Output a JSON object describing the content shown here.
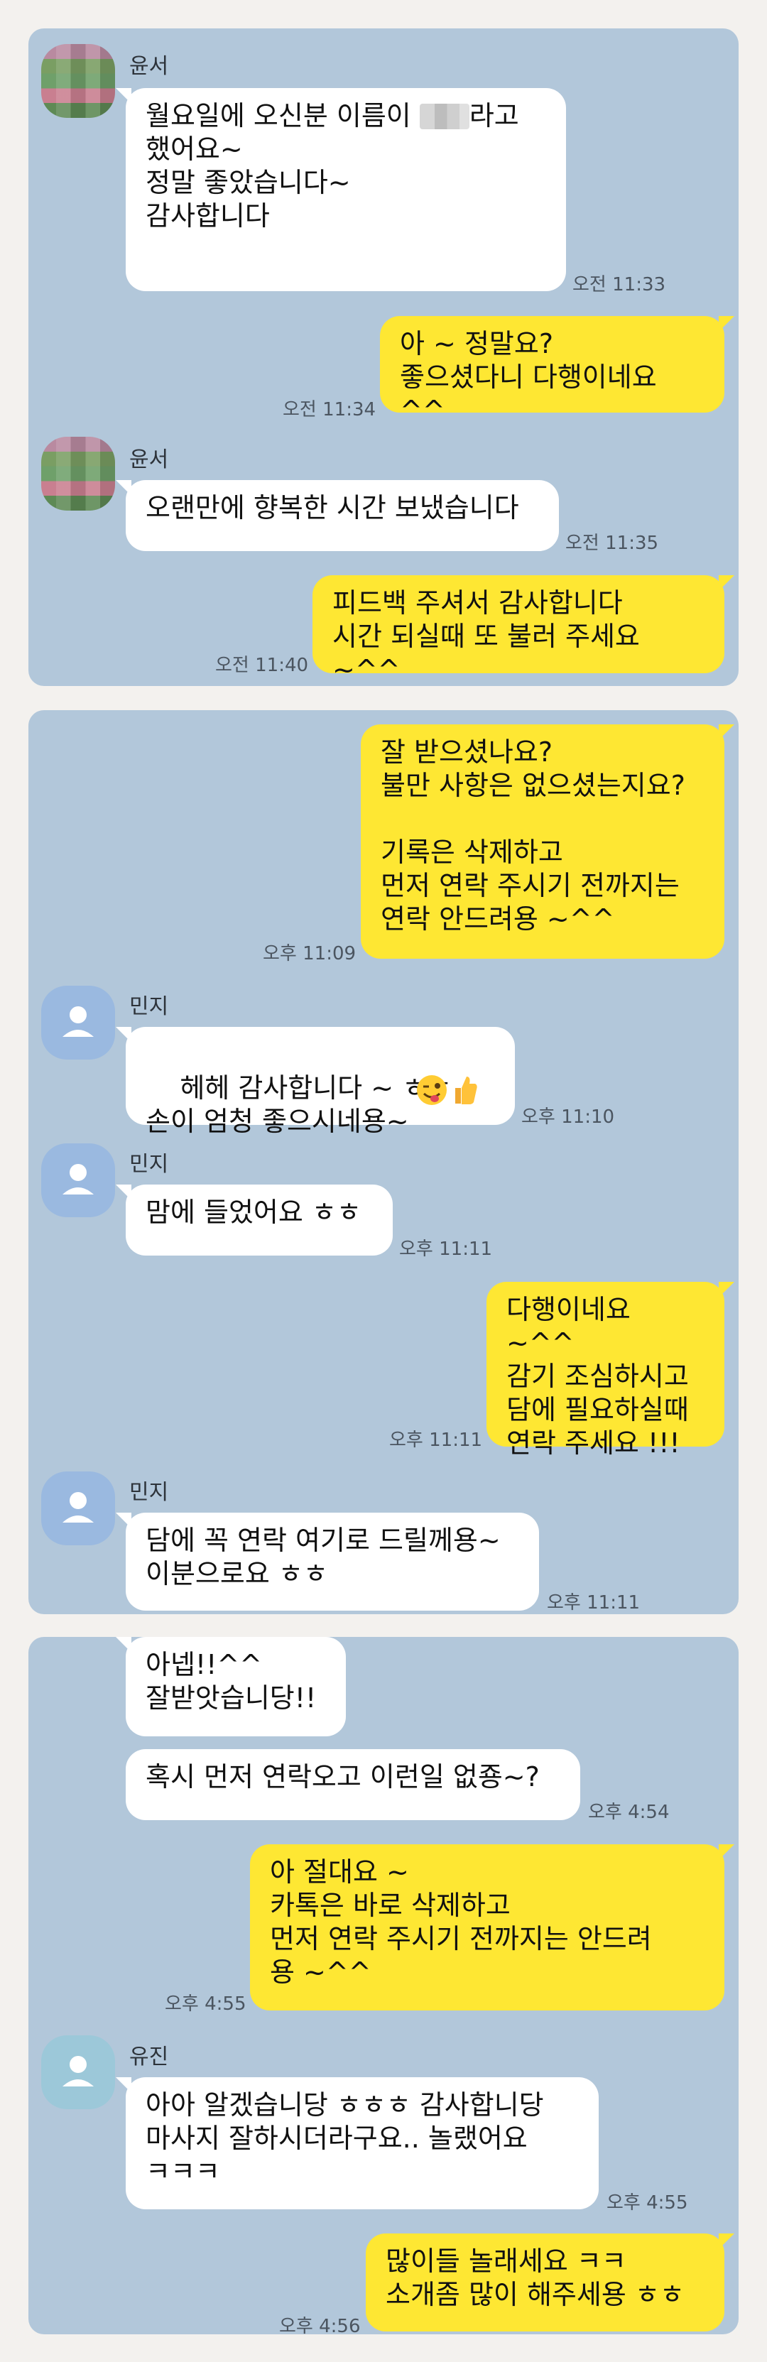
{
  "panel1": {
    "sender1": "윤서",
    "m1": {
      "line1a": "월요일에 오신분 이름이 ",
      "line1b": "라고",
      "rest": "했어요~\n정말 좋았습니다~\n감사합니다",
      "time": "오전 11:33"
    },
    "m2": {
      "text": "아 ~ 정말요?\n좋으셨다니 다행이네요 ^^",
      "time": "오전 11:34"
    },
    "sender2": "윤서",
    "m3": {
      "text": "오랜만에 향복한 시간 보냈습니다",
      "time": "오전 11:35"
    },
    "m4": {
      "text": "피드백 주셔서 감사합니다\n시간 되실때 또 불러 주세요 ~^^",
      "time": "오전 11:40"
    }
  },
  "panel2": {
    "m1": {
      "text": "잘 받으셨나요?\n불만 사항은 없으셨는지요?\n\n기록은 삭제하고\n먼저 연락 주시기 전까지는\n연락 안드려용 ~^^",
      "time": "오후 11:09"
    },
    "sender1": "민지",
    "m2": {
      "text": "헤헤 감사합니다 ~ ㅎㅎ\n손이 엄청 좋으시네용~",
      "time": "오후 11:10"
    },
    "sender2": "민지",
    "m3": {
      "text": "맘에 들었어요 ㅎㅎ",
      "time": "오후 11:11"
    },
    "m4": {
      "text": "다행이네요 ~^^\n감기 조심하시고\n담에 필요하실때\n연락 주세요 !!!",
      "time": "오후 11:11"
    },
    "sender3": "민지",
    "m5": {
      "text": "담에 꼭 연락 여기로 드릴께용~\n이분으로요 ㅎㅎ",
      "time": "오후 11:11"
    }
  },
  "panel3": {
    "m1": {
      "text": "아넵!!^^\n잘받앗습니당!!"
    },
    "m2": {
      "text": "혹시 먼저 연락오고 이런일 없죵~?",
      "time": "오후 4:54"
    },
    "m3": {
      "text": "아 절대요 ~\n카톡은 바로 삭제하고\n먼저 연락 주시기 전까지는 안드려\n용 ~^^",
      "time": "오후 4:55"
    },
    "sender1": "유진",
    "m4": {
      "text": "아아 알겠습니당 ㅎㅎㅎ 감사합니당\n마사지 잘하시더라구요.. 놀랬어요\nㅋㅋㅋ",
      "time": "오후 4:55"
    },
    "m5": {
      "text": "많이들 놀래세요 ㅋㅋ\n소개좀 많이 해주세용 ㅎㅎ",
      "time": "오후 4:56"
    }
  },
  "colors": {
    "chat_bg": "#b2c7da",
    "my_bubble": "#fee733",
    "their_bubble": "#ffffff",
    "page_bg": "#f3f1ee"
  },
  "icons": {
    "default_avatar": "person-silhouette",
    "emoji1": "winking-face-with-tongue",
    "emoji2": "thumbs-up"
  }
}
